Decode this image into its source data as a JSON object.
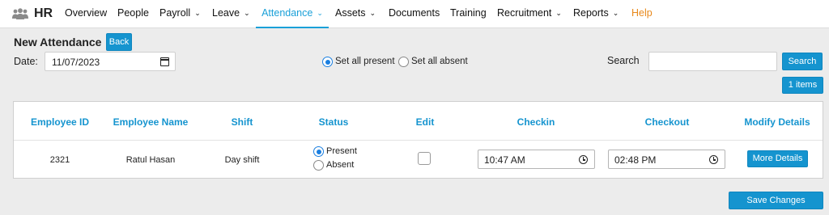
{
  "app": {
    "name": "HR",
    "logo_icon": "people-group-icon"
  },
  "nav": {
    "items": [
      {
        "label": "Overview",
        "dropdown": false
      },
      {
        "label": "People",
        "dropdown": false
      },
      {
        "label": "Payroll",
        "dropdown": true
      },
      {
        "label": "Leave",
        "dropdown": true
      },
      {
        "label": "Attendance",
        "dropdown": true,
        "active": true
      },
      {
        "label": "Assets",
        "dropdown": true
      },
      {
        "label": "Documents",
        "dropdown": false
      },
      {
        "label": "Training",
        "dropdown": false
      },
      {
        "label": "Recruitment",
        "dropdown": true
      },
      {
        "label": "Reports",
        "dropdown": true
      },
      {
        "label": "Help",
        "dropdown": false,
        "accent": true
      }
    ],
    "chevron_glyph": "⌄"
  },
  "page": {
    "title": "New Attendance",
    "back_label": "Back",
    "date_label": "Date:",
    "date_value": "11/07/2023",
    "set_all": {
      "present_label": "Set all present",
      "absent_label": "Set all absent",
      "selected": "present"
    },
    "search_label": "Search",
    "search_value": "",
    "search_button": "Search",
    "items_count_label": "1 items",
    "save_label": "Save Changes"
  },
  "table": {
    "columns": [
      "Employee ID",
      "Employee Name",
      "Shift",
      "Status",
      "Edit",
      "Checkin",
      "Checkout",
      "Modify Details"
    ],
    "rows": [
      {
        "employee_id": "2321",
        "employee_name": "Ratul Hasan",
        "shift": "Day shift",
        "status_options": [
          "Present",
          "Absent"
        ],
        "status_selected": "Present",
        "edit_checked": false,
        "checkin": "10:47 AM",
        "checkout": "02:48 PM",
        "modify_label": "More Details"
      }
    ]
  },
  "colors": {
    "accent": "#1594cf",
    "help": "#e8891c",
    "background": "#ececec",
    "radio_selected": "#1a7fe0"
  }
}
